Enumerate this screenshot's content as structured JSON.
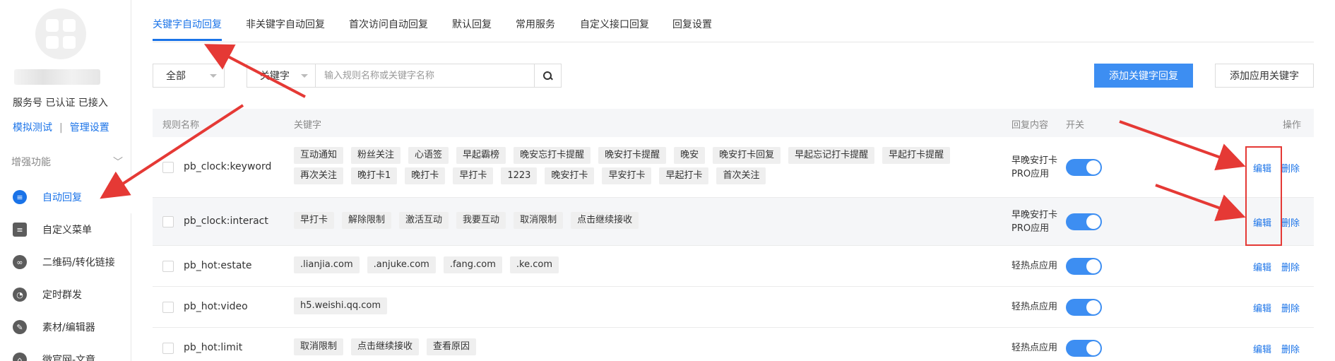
{
  "sidebar": {
    "account_status": "服务号 已认证 已接入",
    "links": [
      "模拟测试",
      "管理设置"
    ],
    "section_label": "增强功能",
    "items": [
      {
        "label": "自动回复",
        "active": true,
        "icon": "chat-icon"
      },
      {
        "label": "自定义菜单",
        "active": false,
        "icon": "menu-doc-icon"
      },
      {
        "label": "二维码/转化链接",
        "active": false,
        "icon": "qrcode-link-icon"
      },
      {
        "label": "定时群发",
        "active": false,
        "icon": "clock-icon"
      },
      {
        "label": "素材/编辑器",
        "active": false,
        "icon": "edit-icon"
      },
      {
        "label": "微官网-文章",
        "active": false,
        "icon": "house-icon"
      }
    ]
  },
  "tabs": [
    {
      "label": "关键字自动回复",
      "active": true
    },
    {
      "label": "非关键字自动回复",
      "active": false
    },
    {
      "label": "首次访问自动回复",
      "active": false
    },
    {
      "label": "默认回复",
      "active": false
    },
    {
      "label": "常用服务",
      "active": false
    },
    {
      "label": "自定义接口回复",
      "active": false
    },
    {
      "label": "回复设置",
      "active": false
    }
  ],
  "filter": {
    "scope_value": "全部",
    "field_value": "关键字",
    "search_placeholder": "输入规则名称或关键字名称",
    "add_keyword_reply": "添加关键字回复",
    "add_app_keyword": "添加应用关键字"
  },
  "table": {
    "headers": {
      "name": "规则名称",
      "keywords": "关键字",
      "reply": "回复内容",
      "switch": "开关",
      "ops": "操作"
    },
    "rows": [
      {
        "name": "pb_clock:keyword",
        "keywords": [
          "互动通知",
          "粉丝关注",
          "心语签",
          "早起霸榜",
          "晚安忘打卡提醒",
          "晚安打卡提醒",
          "晚安",
          "晚安打卡回复",
          "早起忘记打卡提醒",
          "早起打卡提醒",
          "再次关注",
          "晚打卡1",
          "晚打卡",
          "早打卡",
          "1223",
          "晚安打卡",
          "早安打卡",
          "早起打卡",
          "首次关注"
        ],
        "reply": "早晚安打卡\nPRO应用",
        "enabled": true,
        "edit": "编辑",
        "delete": "删除"
      },
      {
        "name": "pb_clock:interact",
        "keywords": [
          "早打卡",
          "解除限制",
          "激活互动",
          "我要互动",
          "取消限制",
          "点击继续接收"
        ],
        "reply": "早晚安打卡\nPRO应用",
        "enabled": true,
        "edit": "编辑",
        "delete": "删除"
      },
      {
        "name": "pb_hot:estate",
        "keywords": [
          ".lianjia.com",
          ".anjuke.com",
          ".fang.com",
          ".ke.com"
        ],
        "reply": "轻热点应用",
        "enabled": true,
        "edit": "编辑",
        "delete": "删除"
      },
      {
        "name": "pb_hot:video",
        "keywords": [
          "h5.weishi.qq.com"
        ],
        "reply": "轻热点应用",
        "enabled": true,
        "edit": "编辑",
        "delete": "删除"
      },
      {
        "name": "pb_hot:limit",
        "keywords": [
          "取消限制",
          "点击继续接收",
          "查看原因"
        ],
        "reply": "轻热点应用",
        "enabled": true,
        "edit": "编辑",
        "delete": "删除"
      }
    ]
  },
  "colors": {
    "accent": "#1a73e8",
    "primary_button": "#3d8ef2",
    "annotation": "#e53935"
  }
}
